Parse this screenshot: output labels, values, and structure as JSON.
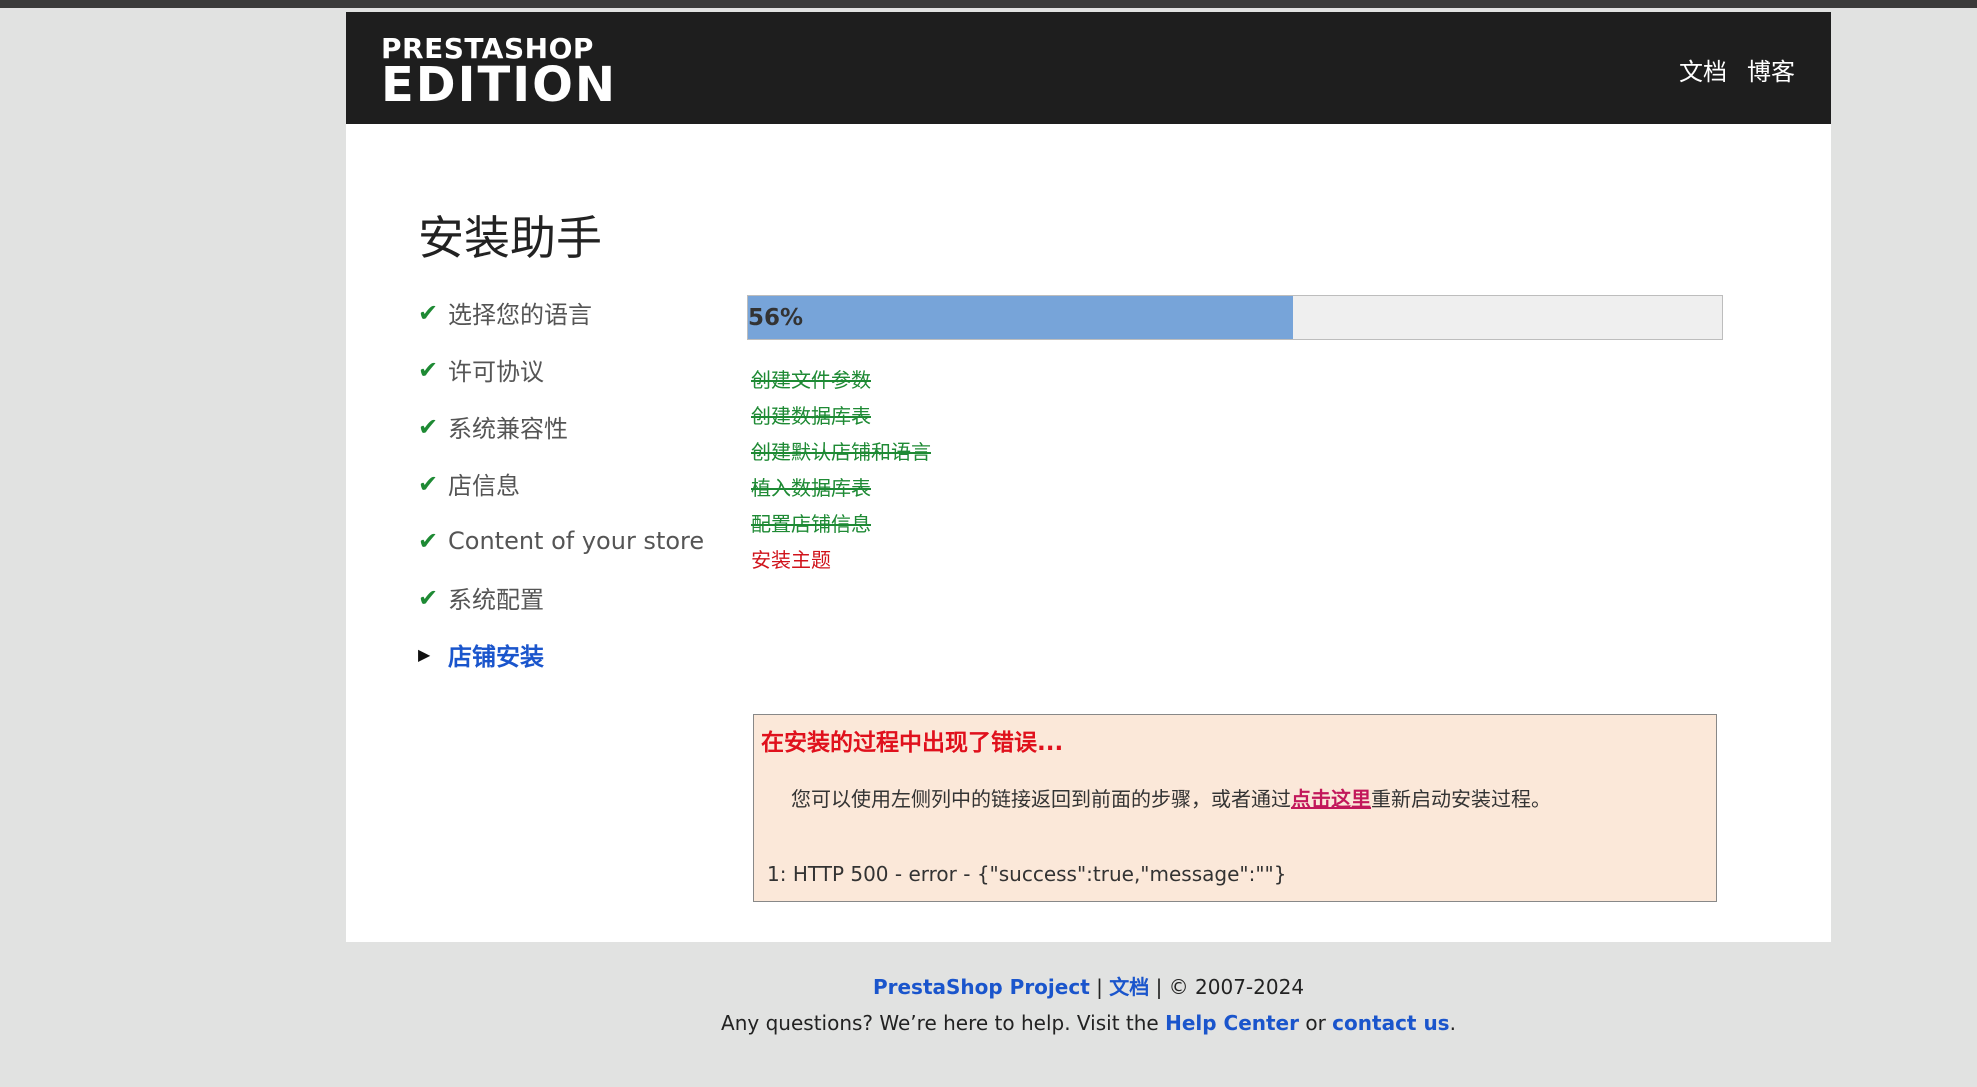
{
  "header": {
    "logo_line1": "PRESTASHOP",
    "logo_line2": "EDITION",
    "nav": {
      "docs": "文档",
      "blog": "博客"
    }
  },
  "page_title": "安装助手",
  "steps": [
    {
      "label": "选择您的语言",
      "done": true
    },
    {
      "label": "许可协议",
      "done": true
    },
    {
      "label": "系统兼容性",
      "done": true
    },
    {
      "label": "店信息",
      "done": true
    },
    {
      "label": "Content of your store",
      "done": true
    },
    {
      "label": "系统配置",
      "done": true
    },
    {
      "label": "店铺安装",
      "done": false,
      "current": true
    }
  ],
  "progress": {
    "percent": 56,
    "label": "56%",
    "fill_color": "#77a4d9"
  },
  "tasks": [
    {
      "label": "创建文件参数",
      "status": "done"
    },
    {
      "label": "创建数据库表",
      "status": "done"
    },
    {
      "label": "创建默认店铺和语言",
      "status": "done"
    },
    {
      "label": "植入数据库表",
      "status": "done"
    },
    {
      "label": "配置店铺信息",
      "status": "done"
    },
    {
      "label": "安装主题",
      "status": "failed"
    }
  ],
  "error": {
    "title": "在安装的过程中出现了错误...",
    "message_before": "您可以使用左侧列中的链接返回到前面的步骤，或者通过",
    "link": "点击这里",
    "message_after": "重新启动安装过程。",
    "detail": "1: HTTP 500 - error - {\"success\":true,\"message\":\"\"}"
  },
  "footer": {
    "project_link": "PrestaShop Project",
    "sep1": " | ",
    "docs_link": "文档",
    "copyright": " | © 2007-2024",
    "question": "Any questions? We’re here to help. Visit the ",
    "help_link": "Help Center",
    "or": " or ",
    "contact_link": "contact us",
    "end": "."
  },
  "icons": {
    "done": "check-icon",
    "current": "triangle-right-icon"
  },
  "colors": {
    "success": "#1e8a34",
    "error": "#e0101c",
    "accent": "#1a55cc",
    "header_bg": "#1e1e1e"
  }
}
